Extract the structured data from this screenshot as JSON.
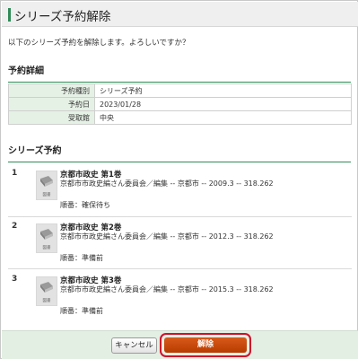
{
  "header": {
    "title": "シリーズ予約解除"
  },
  "confirm_text": "以下のシリーズ予約を解除します。よろしいですか？",
  "details": {
    "heading": "予約詳細",
    "rows": [
      {
        "label": "予約種別",
        "value": "シリーズ予約"
      },
      {
        "label": "予約日",
        "value": "2023/01/28"
      },
      {
        "label": "受取館",
        "value": "中央"
      }
    ]
  },
  "series": {
    "heading": "シリーズ予約",
    "thumbnail_caption": "図書",
    "items": [
      {
        "num": "1",
        "title": "京都市政史 第1巻",
        "meta": "京都市市政史編さん委員会／編集 -- 京都市 -- 2009.3 -- 318.262",
        "status": "順番：確保待ち"
      },
      {
        "num": "2",
        "title": "京都市政史 第2巻",
        "meta": "京都市市政史編さん委員会／編集 -- 京都市 -- 2012.3 -- 318.262",
        "status": "順番：準備前"
      },
      {
        "num": "3",
        "title": "京都市政史 第3巻",
        "meta": "京都市市政史編さん委員会／編集 -- 京都市 -- 2015.3 -- 318.262",
        "status": "順番：準備前"
      }
    ]
  },
  "footer": {
    "cancel_label": "キャンセル",
    "release_label": "解除"
  },
  "colors": {
    "accent": "#2e8b57",
    "label_bg": "#e6f1e6",
    "release_button": "#c8490a",
    "highlight_ring": "#d0102a",
    "footer_bg": "#e3efe3"
  }
}
